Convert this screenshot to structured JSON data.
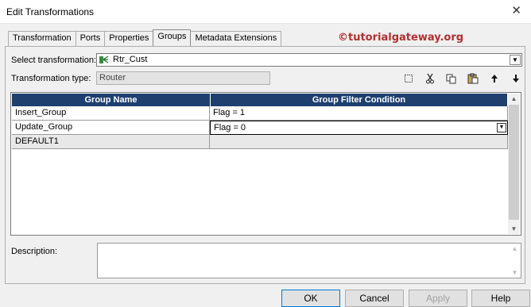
{
  "window": {
    "title": "Edit Transformations",
    "close_glyph": "✕"
  },
  "tabs": [
    {
      "label": "Transformation",
      "active": false
    },
    {
      "label": "Ports",
      "active": false
    },
    {
      "label": "Properties",
      "active": false
    },
    {
      "label": "Groups",
      "active": true
    },
    {
      "label": "Metadata Extensions",
      "active": false
    }
  ],
  "watermark": "©tutorialgateway.org",
  "select_transformation": {
    "label": "Select transformation:",
    "value": "Rtr_Cust",
    "icon": "router-icon"
  },
  "transformation_type": {
    "label": "Transformation type:",
    "value": "Router"
  },
  "toolbar": {
    "icons": [
      "new-icon",
      "cut-icon",
      "copy-icon",
      "paste-icon",
      "move-up-icon",
      "move-down-icon"
    ]
  },
  "grid": {
    "columns": [
      "Group Name",
      "Group Filter Condition"
    ],
    "rows": [
      {
        "name": "Insert_Group",
        "condition": "Flag = 1"
      },
      {
        "name": "Update_Group",
        "condition": "Flag = 0"
      },
      {
        "name": "DEFAULT1",
        "condition": ""
      }
    ],
    "header_color": "#1f3f6e"
  },
  "description": {
    "label": "Description:",
    "value": ""
  },
  "buttons": {
    "ok": "OK",
    "cancel": "Cancel",
    "apply": "Apply",
    "help": "Help"
  }
}
